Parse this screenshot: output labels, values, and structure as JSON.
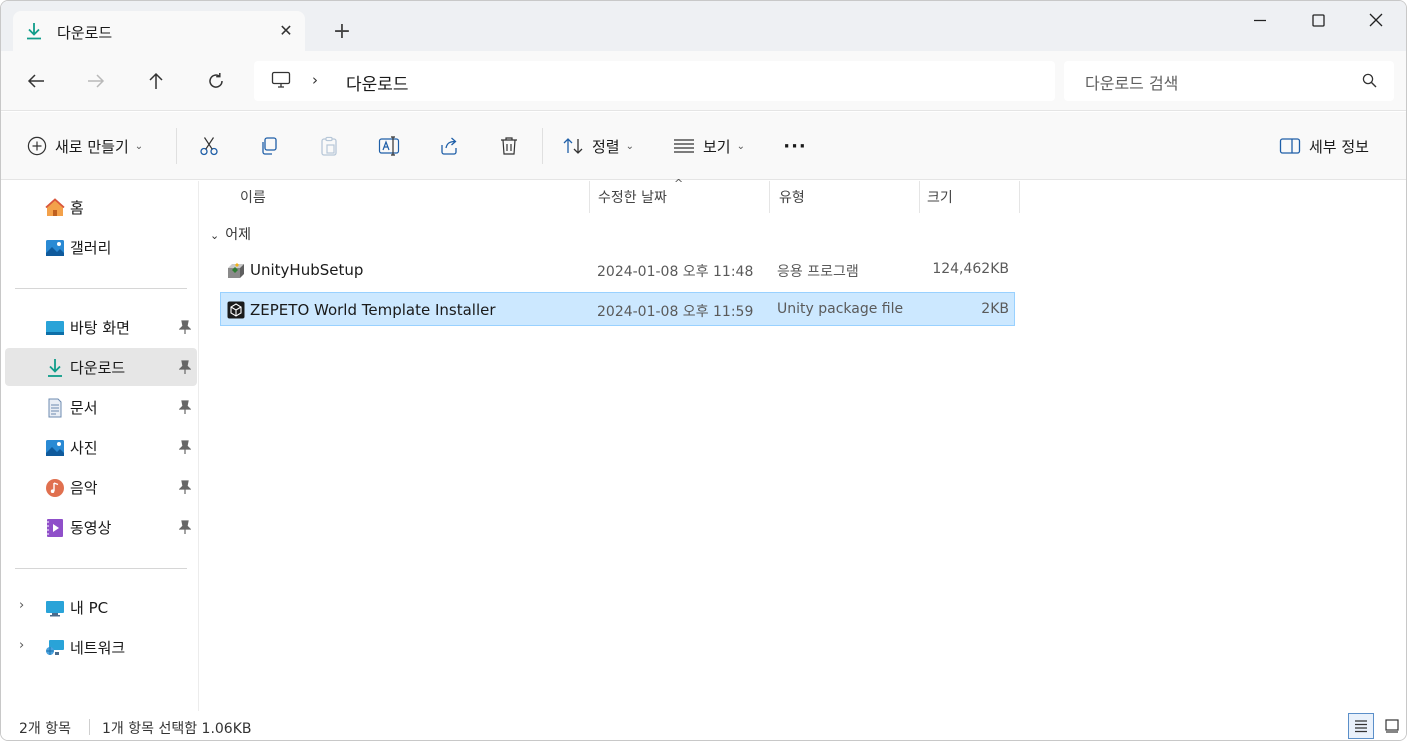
{
  "tab": {
    "title": "다운로드",
    "close_glyph": "✕",
    "new_tab_glyph": "+"
  },
  "address": {
    "breadcrumb_separator": "›",
    "breadcrumb": "다운로드"
  },
  "search": {
    "placeholder": "다운로드 검색"
  },
  "toolbar": {
    "new_label": "새로 만들기",
    "sort_label": "정렬",
    "view_label": "보기",
    "more_glyph": "···",
    "details_label": "세부 정보",
    "dropdown_glyph": "⌄"
  },
  "sidebar": {
    "items": [
      {
        "label": "홈",
        "icon": "home-icon"
      },
      {
        "label": "갤러리",
        "icon": "gallery-icon"
      },
      {
        "label": "바탕 화면",
        "icon": "desktop-icon",
        "pinned": true
      },
      {
        "label": "다운로드",
        "icon": "download-icon",
        "pinned": true,
        "selected": true
      },
      {
        "label": "문서",
        "icon": "documents-icon",
        "pinned": true
      },
      {
        "label": "사진",
        "icon": "pictures-icon",
        "pinned": true
      },
      {
        "label": "음악",
        "icon": "music-icon",
        "pinned": true
      },
      {
        "label": "동영상",
        "icon": "videos-icon",
        "pinned": true
      },
      {
        "label": "내 PC",
        "icon": "this-pc-icon",
        "expandable": true
      },
      {
        "label": "네트워크",
        "icon": "network-icon",
        "expandable": true
      }
    ]
  },
  "columns": {
    "name": "이름",
    "modified": "수정한 날짜",
    "type": "유형",
    "size": "크기"
  },
  "group": {
    "label": "어제",
    "chevron": "⌄"
  },
  "files": [
    {
      "name": "UnityHubSetup",
      "modified": "2024-01-08 오후 11:48",
      "type": "응용 프로그램",
      "size": "124,462KB",
      "icon": "installer-icon"
    },
    {
      "name": "ZEPETO World Template Installer",
      "modified": "2024-01-08 오후 11:59",
      "type": "Unity package file",
      "size": "2KB",
      "icon": "unity-package-icon",
      "selected": true
    }
  ],
  "status": {
    "count": "2개 항목",
    "selection": "1개 항목 선택함 1.06KB"
  },
  "colors": {
    "accent": "#0f9d8a",
    "selection": "#cce8ff",
    "selection_border": "#99d1ff"
  }
}
